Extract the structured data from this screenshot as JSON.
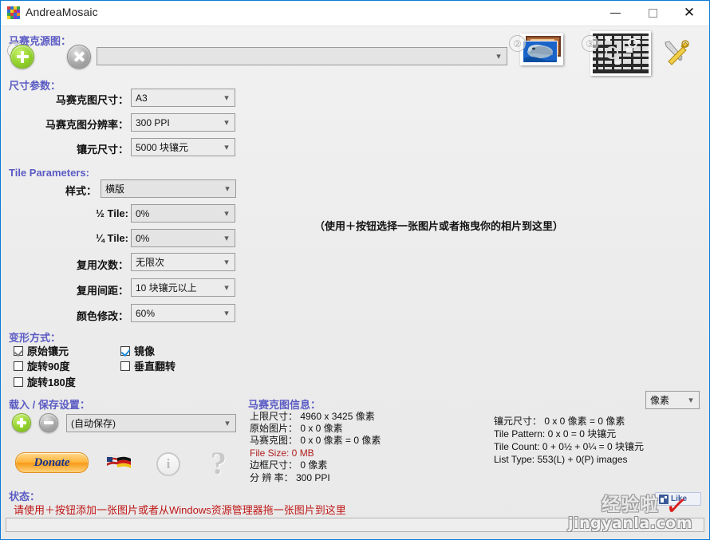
{
  "window": {
    "title": "AndreaMosaic",
    "minimize_label": "—",
    "maximize_label": "",
    "close_label": "✕"
  },
  "source_section": {
    "header": "马赛克源图：",
    "step_badge": "①",
    "add_button_label": "+",
    "clear_button_label": "✕",
    "path_value": "",
    "path_placeholder": ""
  },
  "size_section": {
    "header": "尺寸参数：",
    "rows": [
      {
        "label": "马赛克图尺寸：",
        "value": "A3"
      },
      {
        "label": "马赛克图分辨率：",
        "value": "300 PPI"
      },
      {
        "label": "镶元尺寸：",
        "value": "5000 块镶元"
      }
    ]
  },
  "tile_section": {
    "header": "Tile Parameters:",
    "rows": [
      {
        "label": "样式：",
        "value": "横版"
      },
      {
        "label": "½ Tile:",
        "value": "0%"
      },
      {
        "label": "¼ Tile:",
        "value": "0%"
      },
      {
        "label": "复用次数：",
        "value": "无限次"
      },
      {
        "label": "复用间距：",
        "value": "10 块镶元以上"
      },
      {
        "label": "颜色修改：",
        "value": "60%"
      }
    ]
  },
  "transform_section": {
    "header": "变形方式：",
    "items": [
      {
        "label": "原始镶元",
        "checked": "gray"
      },
      {
        "label": "镜像",
        "checked": "blue"
      },
      {
        "label": "旋转90度",
        "checked": "none"
      },
      {
        "label": "垂直翻转",
        "checked": "none"
      },
      {
        "label": "旋转180度",
        "checked": "none"
      }
    ]
  },
  "settings_section": {
    "header": "载入 / 保存设置：",
    "add_button_label": "+",
    "remove_button_label": "−",
    "preset_value": "(自动保存)",
    "donate_label": "Donate",
    "language_icon": "flag-icon",
    "info_icon": "info-icon",
    "help_icon": "help-icon"
  },
  "drop_zone": {
    "text": "（使用＋按钮选择一张图片或者拖曳你的相片到这里）"
  },
  "toolbar": {
    "thumb2_badge": "②",
    "thumb3_badge": "③",
    "thumb2_name": "dolphin-photo-thumbnail",
    "thumb3_name": "mosaic-preview-thumbnail",
    "tools_icon": "tools-icon"
  },
  "mosaic_info": {
    "header": "马赛克图信息：",
    "lines": [
      "上限尺寸： 4960 x 3425 像素",
      "原始图片： 0 x 0 像素",
      "马赛克图： 0 x 0 像素 = 0 像素",
      "File Size: 0 MB",
      "边框尺寸： 0 像素",
      "分 辨 率： 300 PPI"
    ]
  },
  "tile_info": {
    "unit_value": "像素",
    "lines": [
      "镶元尺寸： 0 x 0 像素 = 0 像素",
      "Tile Pattern: 0 x 0 = 0 块镶元",
      "Tile Count: 0 + 0½ + 0¼ = 0 块镶元",
      "List Type: 553(L) + 0(P) images"
    ]
  },
  "status_section": {
    "header": "状态：",
    "message": "请使用＋按钮添加一张图片或者从Windows资源管理器拖一张图片到这里",
    "progress_value": ""
  },
  "like_widget": {
    "label": "Like"
  },
  "watermark": {
    "line1": "经验啦",
    "line2": "jingyanla.com"
  },
  "colors": {
    "header_blue": "#5b5bc4",
    "status_red": "#c01616",
    "accent_green": "#92d12c",
    "title_accent": "#0a7ad6"
  }
}
